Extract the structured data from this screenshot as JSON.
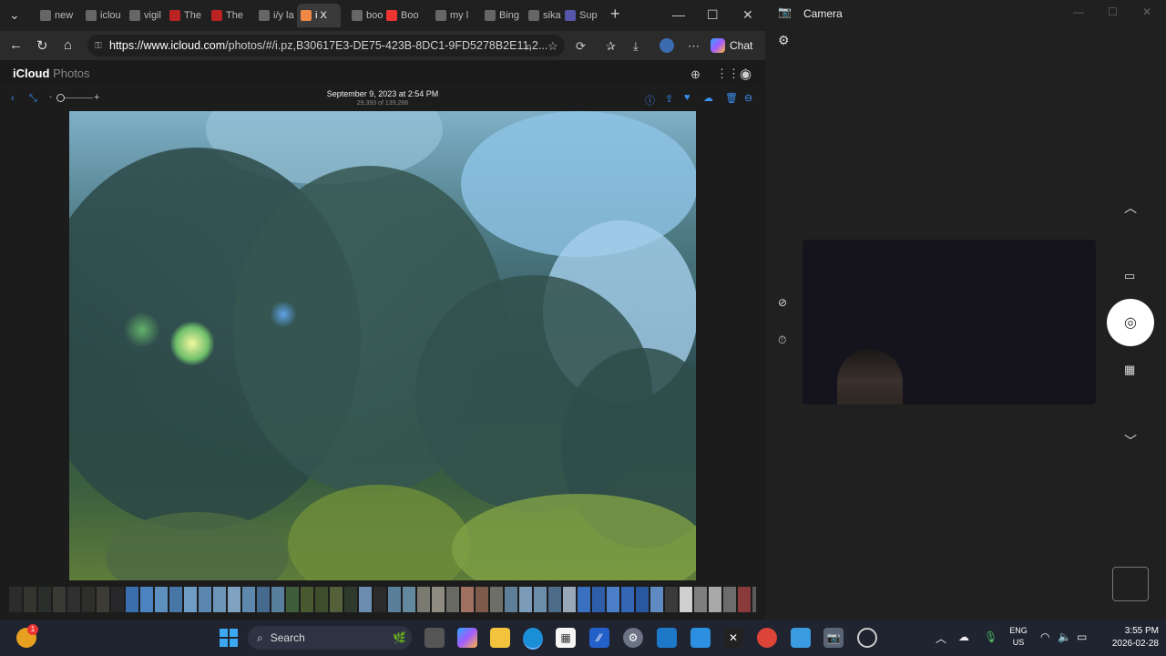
{
  "browser": {
    "tabs": [
      {
        "label": "new",
        "color": "#666"
      },
      {
        "label": "iclou",
        "color": "#666"
      },
      {
        "label": "vigil",
        "color": "#666"
      },
      {
        "label": "The",
        "color": "#b22"
      },
      {
        "label": "The",
        "color": "#b22"
      },
      {
        "label": "i/y la",
        "color": "#666"
      },
      {
        "label": "i X",
        "color": "#e84"
      },
      {
        "label": "boo",
        "color": "#666"
      },
      {
        "label": "Boo",
        "color": "#e33"
      },
      {
        "label": "my l",
        "color": "#666"
      },
      {
        "label": "Bing",
        "color": "#666"
      },
      {
        "label": "sika",
        "color": "#666"
      },
      {
        "label": "Sup",
        "color": "#55a"
      }
    ],
    "url_host": "https://www.icloud.com",
    "url_path": "/photos/#/i.pz,B30617E3-DE75-423B-8DC1-9FD5278B2E11,2...",
    "chat_label": "Chat"
  },
  "icloud": {
    "brand": "iCloud",
    "section": "Photos",
    "photo_date": "September 9, 2023 at 2:54 PM",
    "photo_count": "29,393 of 139,286"
  },
  "camera": {
    "title": "Camera"
  },
  "taskbar": {
    "search_placeholder": "Search",
    "lang_line1": "ENG",
    "lang_line2": "US",
    "time": "3:55 PM",
    "date": "2026-02-28",
    "notification_count": "1"
  },
  "colors": {
    "accent": "#3b8ff0",
    "window_bg": "#1c1c1c"
  }
}
